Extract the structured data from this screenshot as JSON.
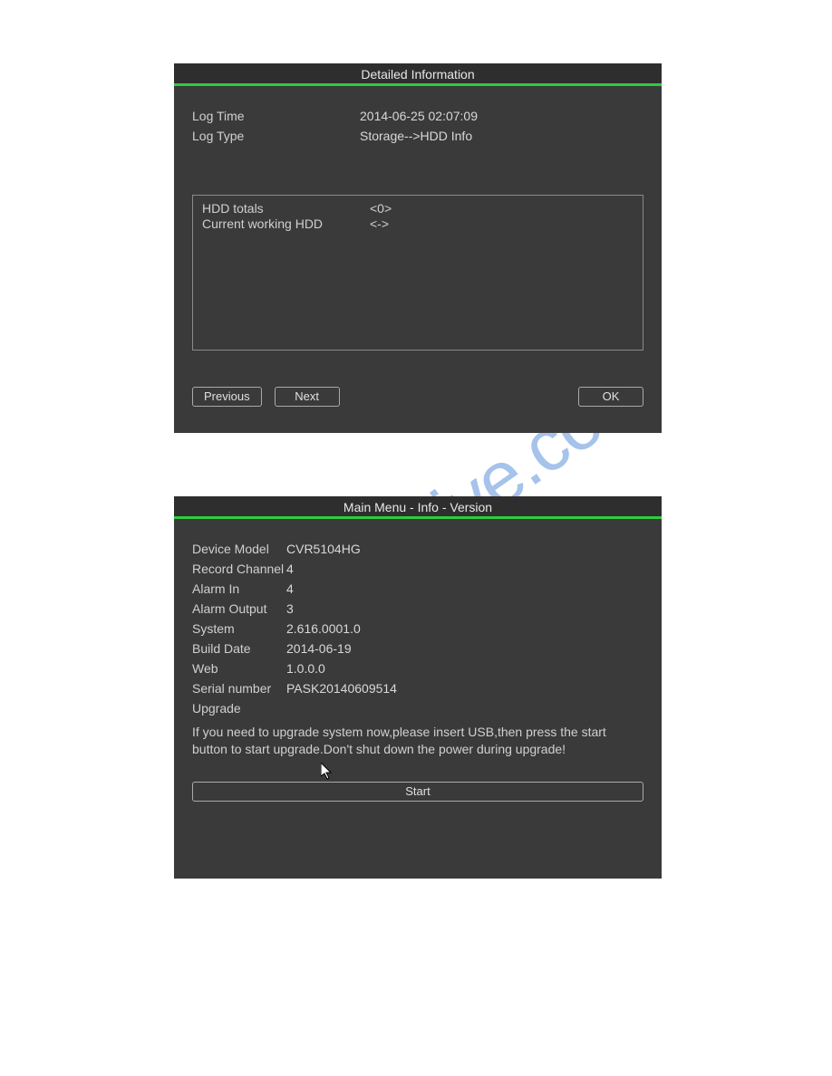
{
  "watermark": "manualshive.com",
  "panel1": {
    "title": "Detailed Information",
    "log_time_label": "Log Time",
    "log_time_value": "2014-06-25 02:07:09",
    "log_type_label": "Log Type",
    "log_type_value": "Storage-->HDD Info",
    "box": {
      "hdd_totals_label": "HDD totals",
      "hdd_totals_value": "<0>",
      "current_hdd_label": "Current working HDD",
      "current_hdd_value": "<->"
    },
    "buttons": {
      "previous": "Previous",
      "next": "Next",
      "ok": "OK"
    }
  },
  "panel2": {
    "title": "Main Menu - Info - Version",
    "rows": {
      "device_model_label": "Device Model",
      "device_model_value": "CVR5104HG",
      "record_channel_label": "Record Channel",
      "record_channel_value": "4",
      "alarm_in_label": "Alarm In",
      "alarm_in_value": "4",
      "alarm_output_label": "Alarm Output",
      "alarm_output_value": "3",
      "system_label": "System",
      "system_value": "2.616.0001.0",
      "build_date_label": "Build Date",
      "build_date_value": "2014-06-19",
      "web_label": "Web",
      "web_value": "1.0.0.0",
      "serial_label": "Serial number",
      "serial_value": "PASK20140609514",
      "upgrade_label": "Upgrade"
    },
    "note": "If you need to upgrade system now,please insert USB,then press the start button to start upgrade.Don't shut down the power during upgrade!",
    "start_button": "Start"
  }
}
